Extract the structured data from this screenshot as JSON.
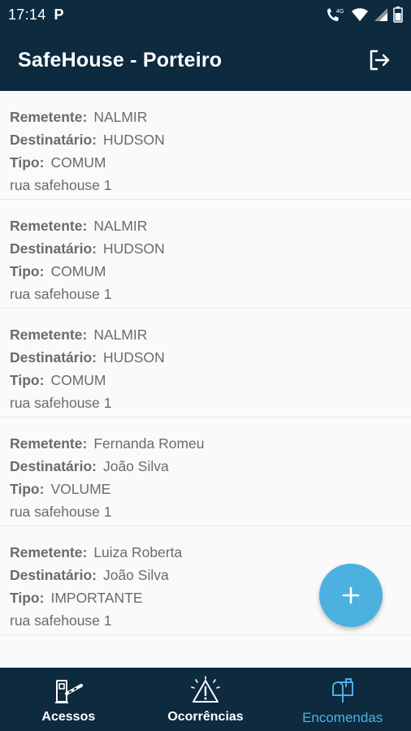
{
  "status_bar": {
    "time": "17:14",
    "notification_letter": "P",
    "network_label": "4G"
  },
  "app_bar": {
    "title": "SafeHouse - Porteiro",
    "logout_icon": "logout-icon"
  },
  "labels": {
    "sender": "Remetente:",
    "recipient": "Destinatário:",
    "type": "Tipo:"
  },
  "packages": [
    {
      "sender": "NALMIR",
      "recipient": "HUDSON",
      "type": "COMUM",
      "address": "rua safehouse 1"
    },
    {
      "sender": "NALMIR",
      "recipient": "HUDSON",
      "type": "COMUM",
      "address": "rua safehouse 1"
    },
    {
      "sender": "NALMIR",
      "recipient": "HUDSON",
      "type": "COMUM",
      "address": "rua safehouse 1"
    },
    {
      "sender": "Fernanda Romeu",
      "recipient": "João  Silva",
      "type": "VOLUME",
      "address": "rua safehouse 1"
    },
    {
      "sender": "Luiza Roberta",
      "recipient": "João  Silva",
      "type": "IMPORTANTE",
      "address": "rua safehouse 1"
    }
  ],
  "fab": {
    "icon": "plus-icon",
    "color": "#4db1e0"
  },
  "bottom_nav": {
    "active": "encomendas",
    "items": [
      {
        "key": "acessos",
        "label": "Acessos",
        "icon": "gate-barrier-icon"
      },
      {
        "key": "ocorrencias",
        "label": "Ocorrências",
        "icon": "warning-icon"
      },
      {
        "key": "encomendas",
        "label": "Encomendas",
        "icon": "mailbox-icon"
      }
    ]
  },
  "colors": {
    "primary_dark": "#0d2a3f",
    "accent": "#4db1e0",
    "text": "#6b6b6b",
    "background": "#fafafa"
  }
}
